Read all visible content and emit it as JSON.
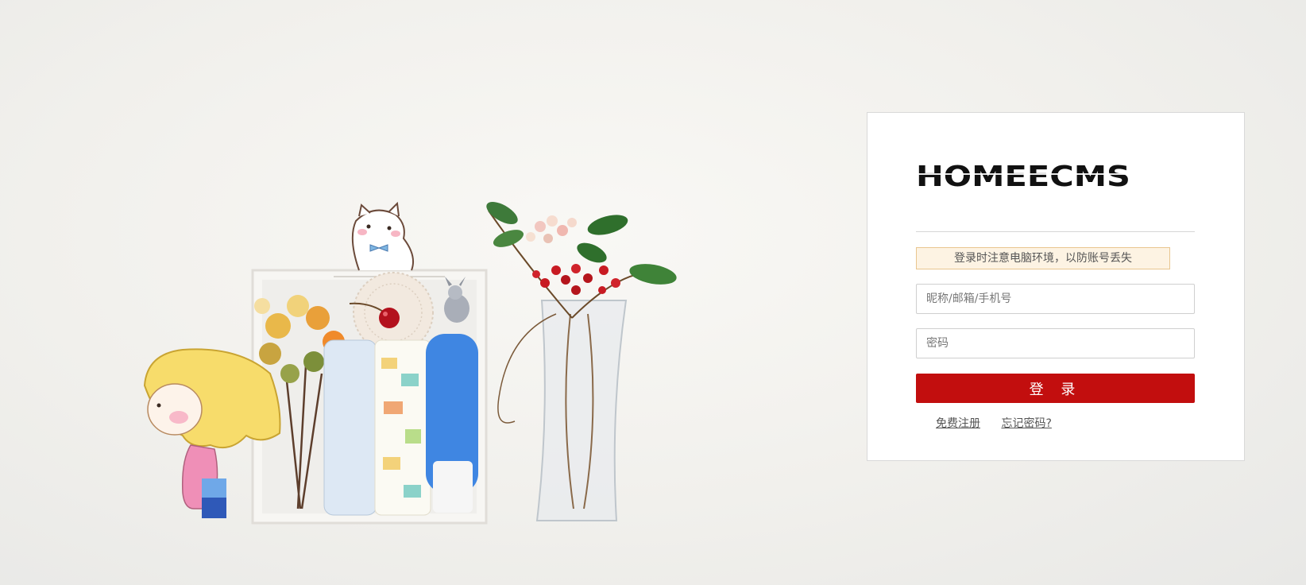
{
  "logo": {
    "text": "HOMEECMS",
    "color": "#111111"
  },
  "notice": {
    "text": "登录时注意电脑环境，以防账号丢失"
  },
  "form": {
    "username_placeholder": "昵称/邮箱/手机号",
    "password_placeholder": "密码",
    "submit_label": "登 录"
  },
  "links": {
    "register": "免费注册",
    "forgot": "忘记密码?"
  },
  "colors": {
    "accent": "#c20e0e",
    "notice_bg": "#fdf3e3",
    "notice_border": "#e9c690"
  },
  "illustration": {
    "items": [
      "cartoon-girl",
      "cartoon-cat",
      "white-wooden-box",
      "dried-flowers",
      "cherry",
      "lace-doily",
      "toy-donkey",
      "folded-towels",
      "glass-vase",
      "red-berries-branch"
    ]
  }
}
